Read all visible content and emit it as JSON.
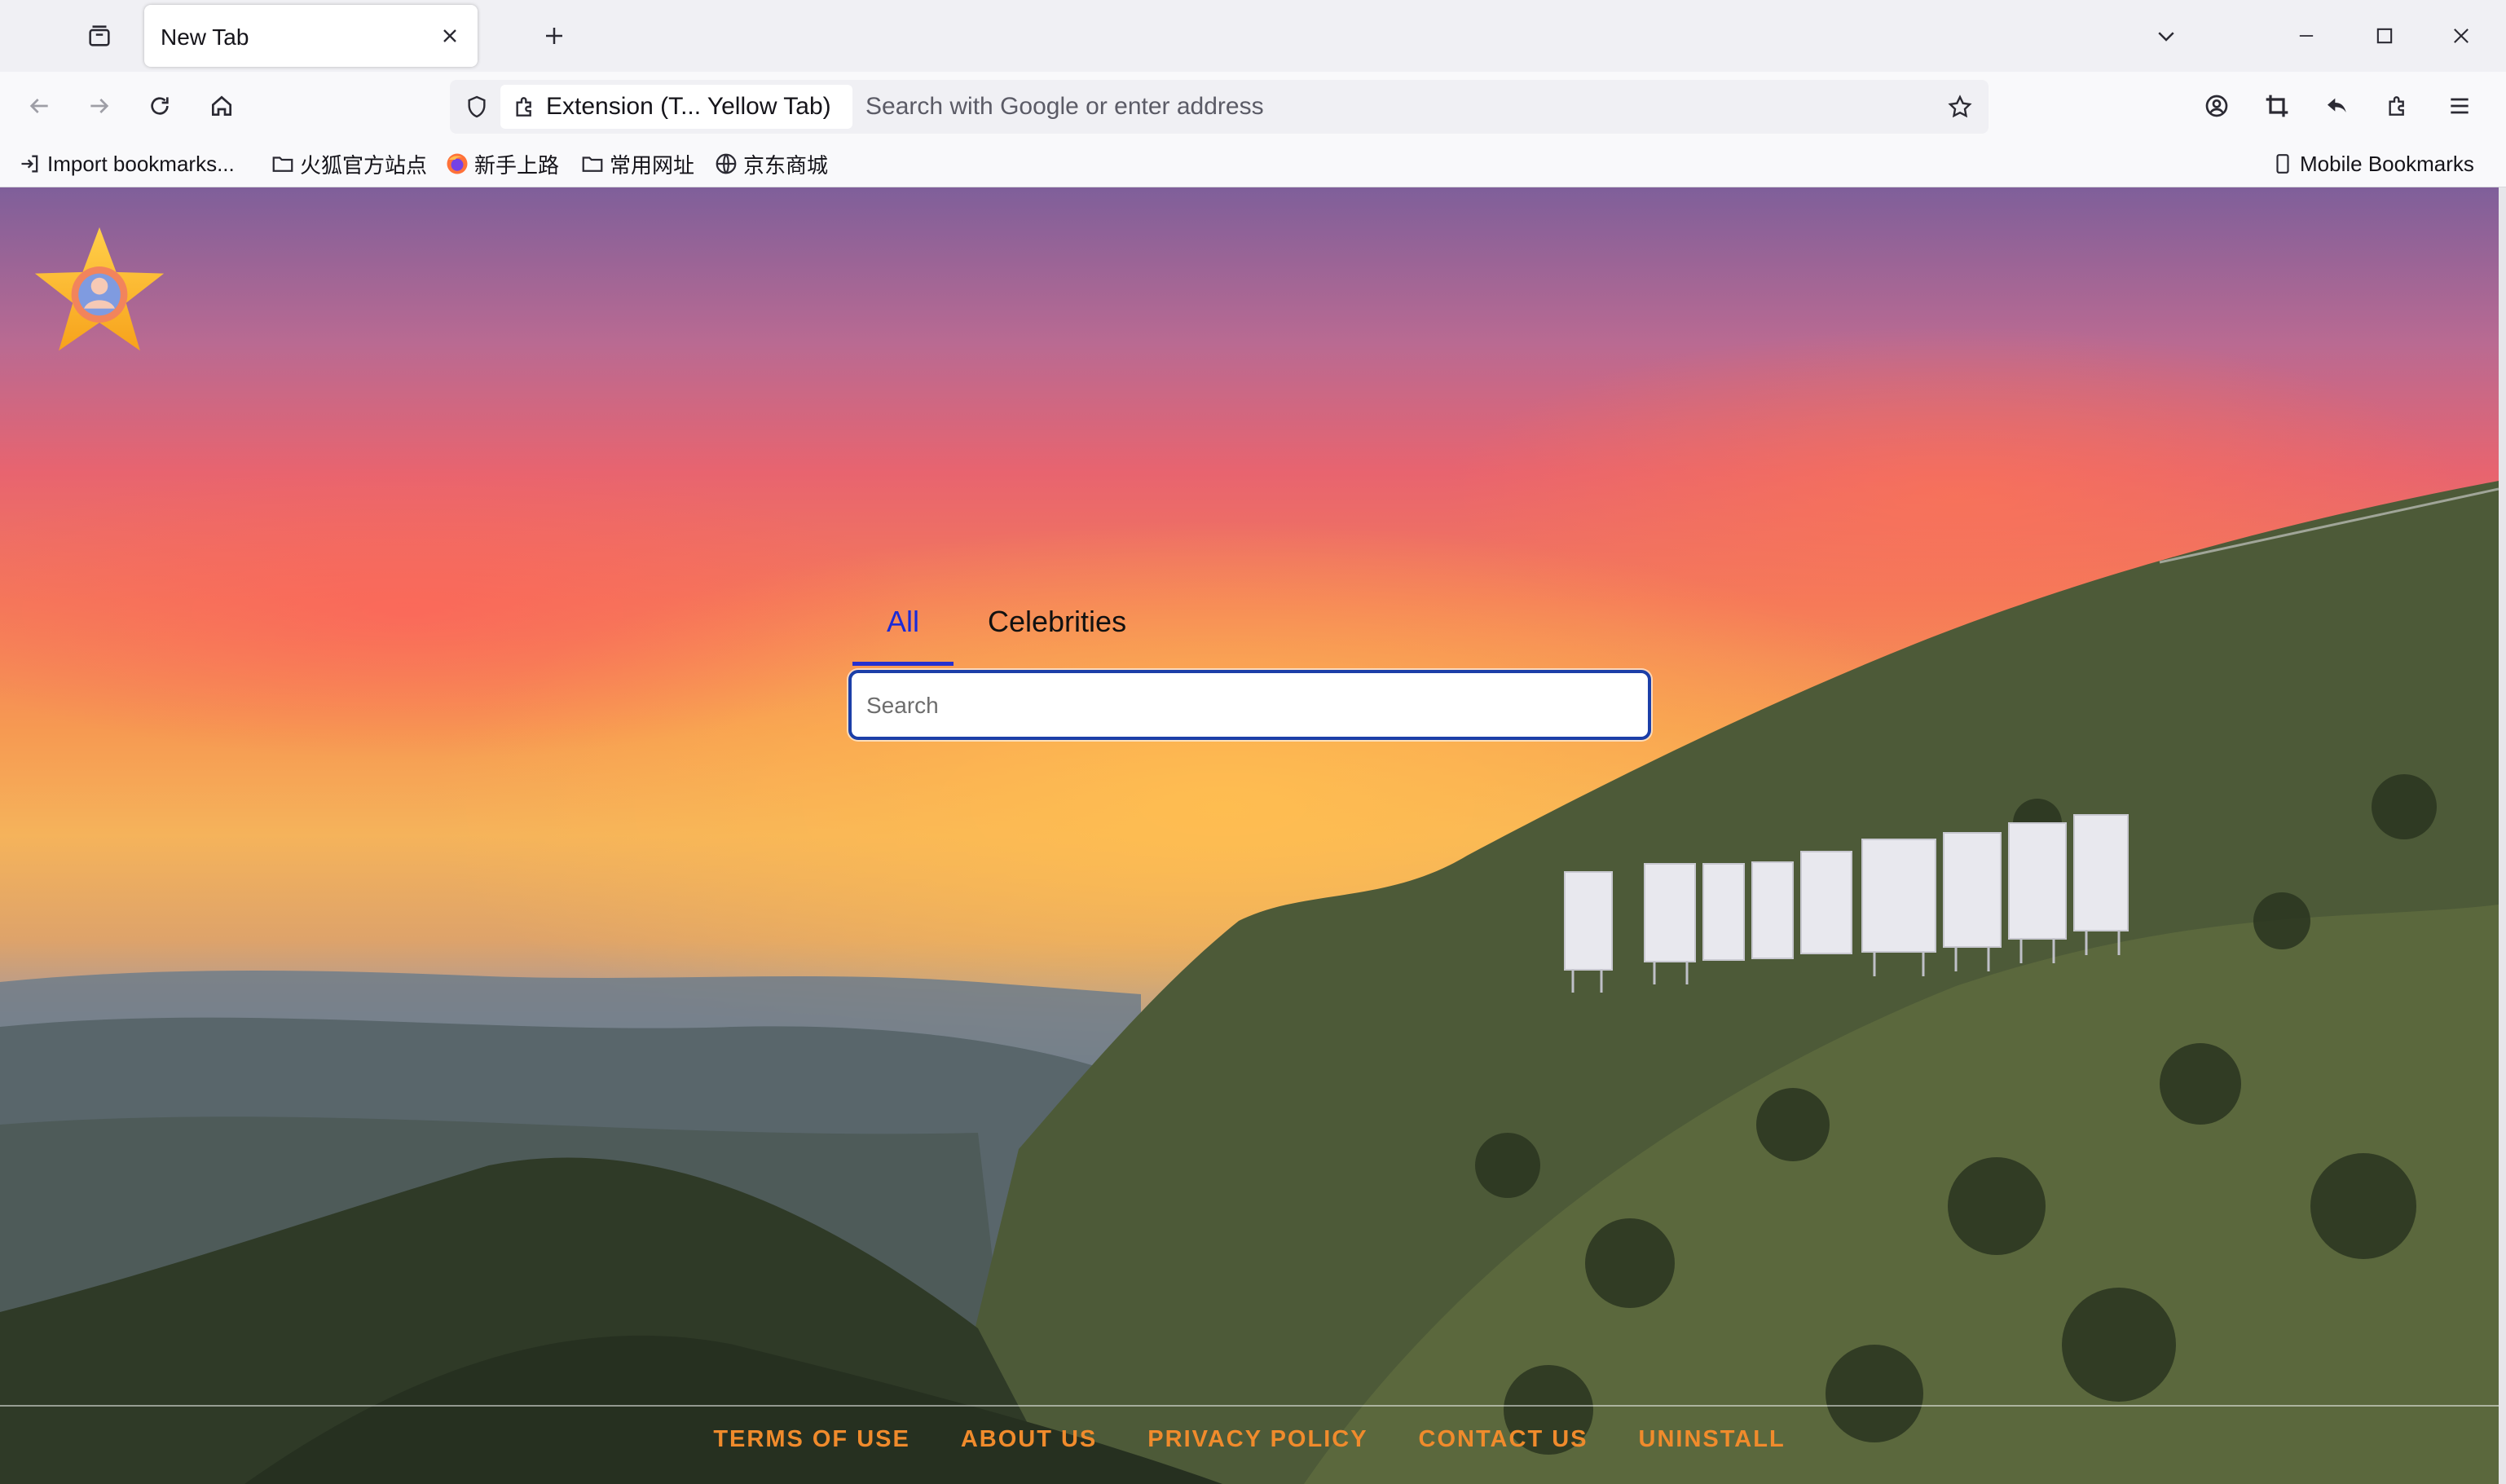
{
  "browser": {
    "tab": {
      "title": "New Tab"
    },
    "urlbar": {
      "extension_label": "Extension (T... Yellow Tab)",
      "placeholder": "Search with Google or enter address"
    },
    "bookmarks": [
      {
        "label": "Import bookmarks...",
        "icon": "import-icon"
      },
      {
        "label": "火狐官方站点",
        "icon": "folder-icon"
      },
      {
        "label": "新手上路",
        "icon": "firefox-icon"
      },
      {
        "label": "常用网址",
        "icon": "folder-icon"
      },
      {
        "label": "京东商城",
        "icon": "globe-icon"
      }
    ],
    "mobile_bookmarks": "Mobile Bookmarks"
  },
  "page": {
    "search_tabs": [
      {
        "label": "All",
        "active": true
      },
      {
        "label": "Celebrities",
        "active": false
      }
    ],
    "search_placeholder": "Search",
    "hollywood_sign": "HOLLYWOOD",
    "footer_links": [
      "TERMS OF USE",
      "ABOUT US",
      "PRIVACY POLICY",
      "CONTACT US",
      "UNINSTALL"
    ]
  },
  "colors": {
    "active_tab": "#1a2ad8",
    "footer_link": "#f08b2c",
    "search_border": "#1c3fa8"
  }
}
